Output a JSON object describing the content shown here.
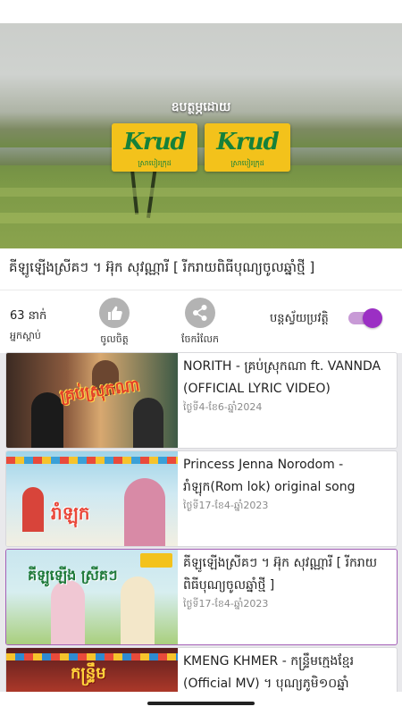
{
  "player": {
    "sponsor_text": "ឧបត្ថម្ភដោយ",
    "logos": [
      {
        "word": "Krud",
        "sub": "ស្រាបៀរក្រុដ"
      },
      {
        "word": "Krud",
        "sub": "ស្រាបៀរក្រុដ"
      }
    ]
  },
  "video": {
    "title": "គីឡូឡើងស្រីគៗ ។ អ៊ុក សុវណ្ណារី [ រីករាយពិធីបុណ្យចូលឆ្នាំថ្មី ]"
  },
  "actions": {
    "count": "63 នាក់",
    "count_label": "អ្នកស្តាប់",
    "like_label": "ចូលចិត្ត",
    "share_label": "ចែករំលែក",
    "autoplay_label": "បន្តស្វ័យប្រវត្តិ",
    "autoplay_on": true
  },
  "playlist": [
    {
      "title": "NORITH - គ្រប់ស្រុកណា ft. VANNDA (OFFICIAL LYRIC VIDEO)",
      "date": "ថ្ងៃទី4-ខែ6-ឆ្នាំ2024",
      "thumb_text": "គ្រប់ស្រុកណា",
      "active": false
    },
    {
      "title": "Princess Jenna Norodom - រាំឡុក(Rom lok) original song",
      "date": "ថ្ងៃទី17-ខែ4-ឆ្នាំ2023",
      "thumb_text": "រាំឡុក",
      "active": false
    },
    {
      "title": "គីឡូឡើងស្រីគៗ ។ អ៊ុក សុវណ្ណារី [ រីករាយពិធីបុណ្យចូលឆ្នាំថ្មី ]",
      "date": "ថ្ងៃទី17-ខែ4-ឆ្នាំ2023",
      "thumb_text": "គីឡូឡើង ស្រីគៗ",
      "active": true
    },
    {
      "title": "KMENG KHMER - កន្ទ្រឹមក្មេងខ្មែរ (Official MV) ។ បុណ្យភូមិ១០ឆ្នាំ",
      "date": "",
      "thumb_text": "កន្ទ្រឹម",
      "active": false
    }
  ],
  "colors": {
    "accent": "#9b2fc4",
    "accent_light": "#c89ad6",
    "icon_gray": "#b3b3b3",
    "active_border": "#a460b7"
  }
}
